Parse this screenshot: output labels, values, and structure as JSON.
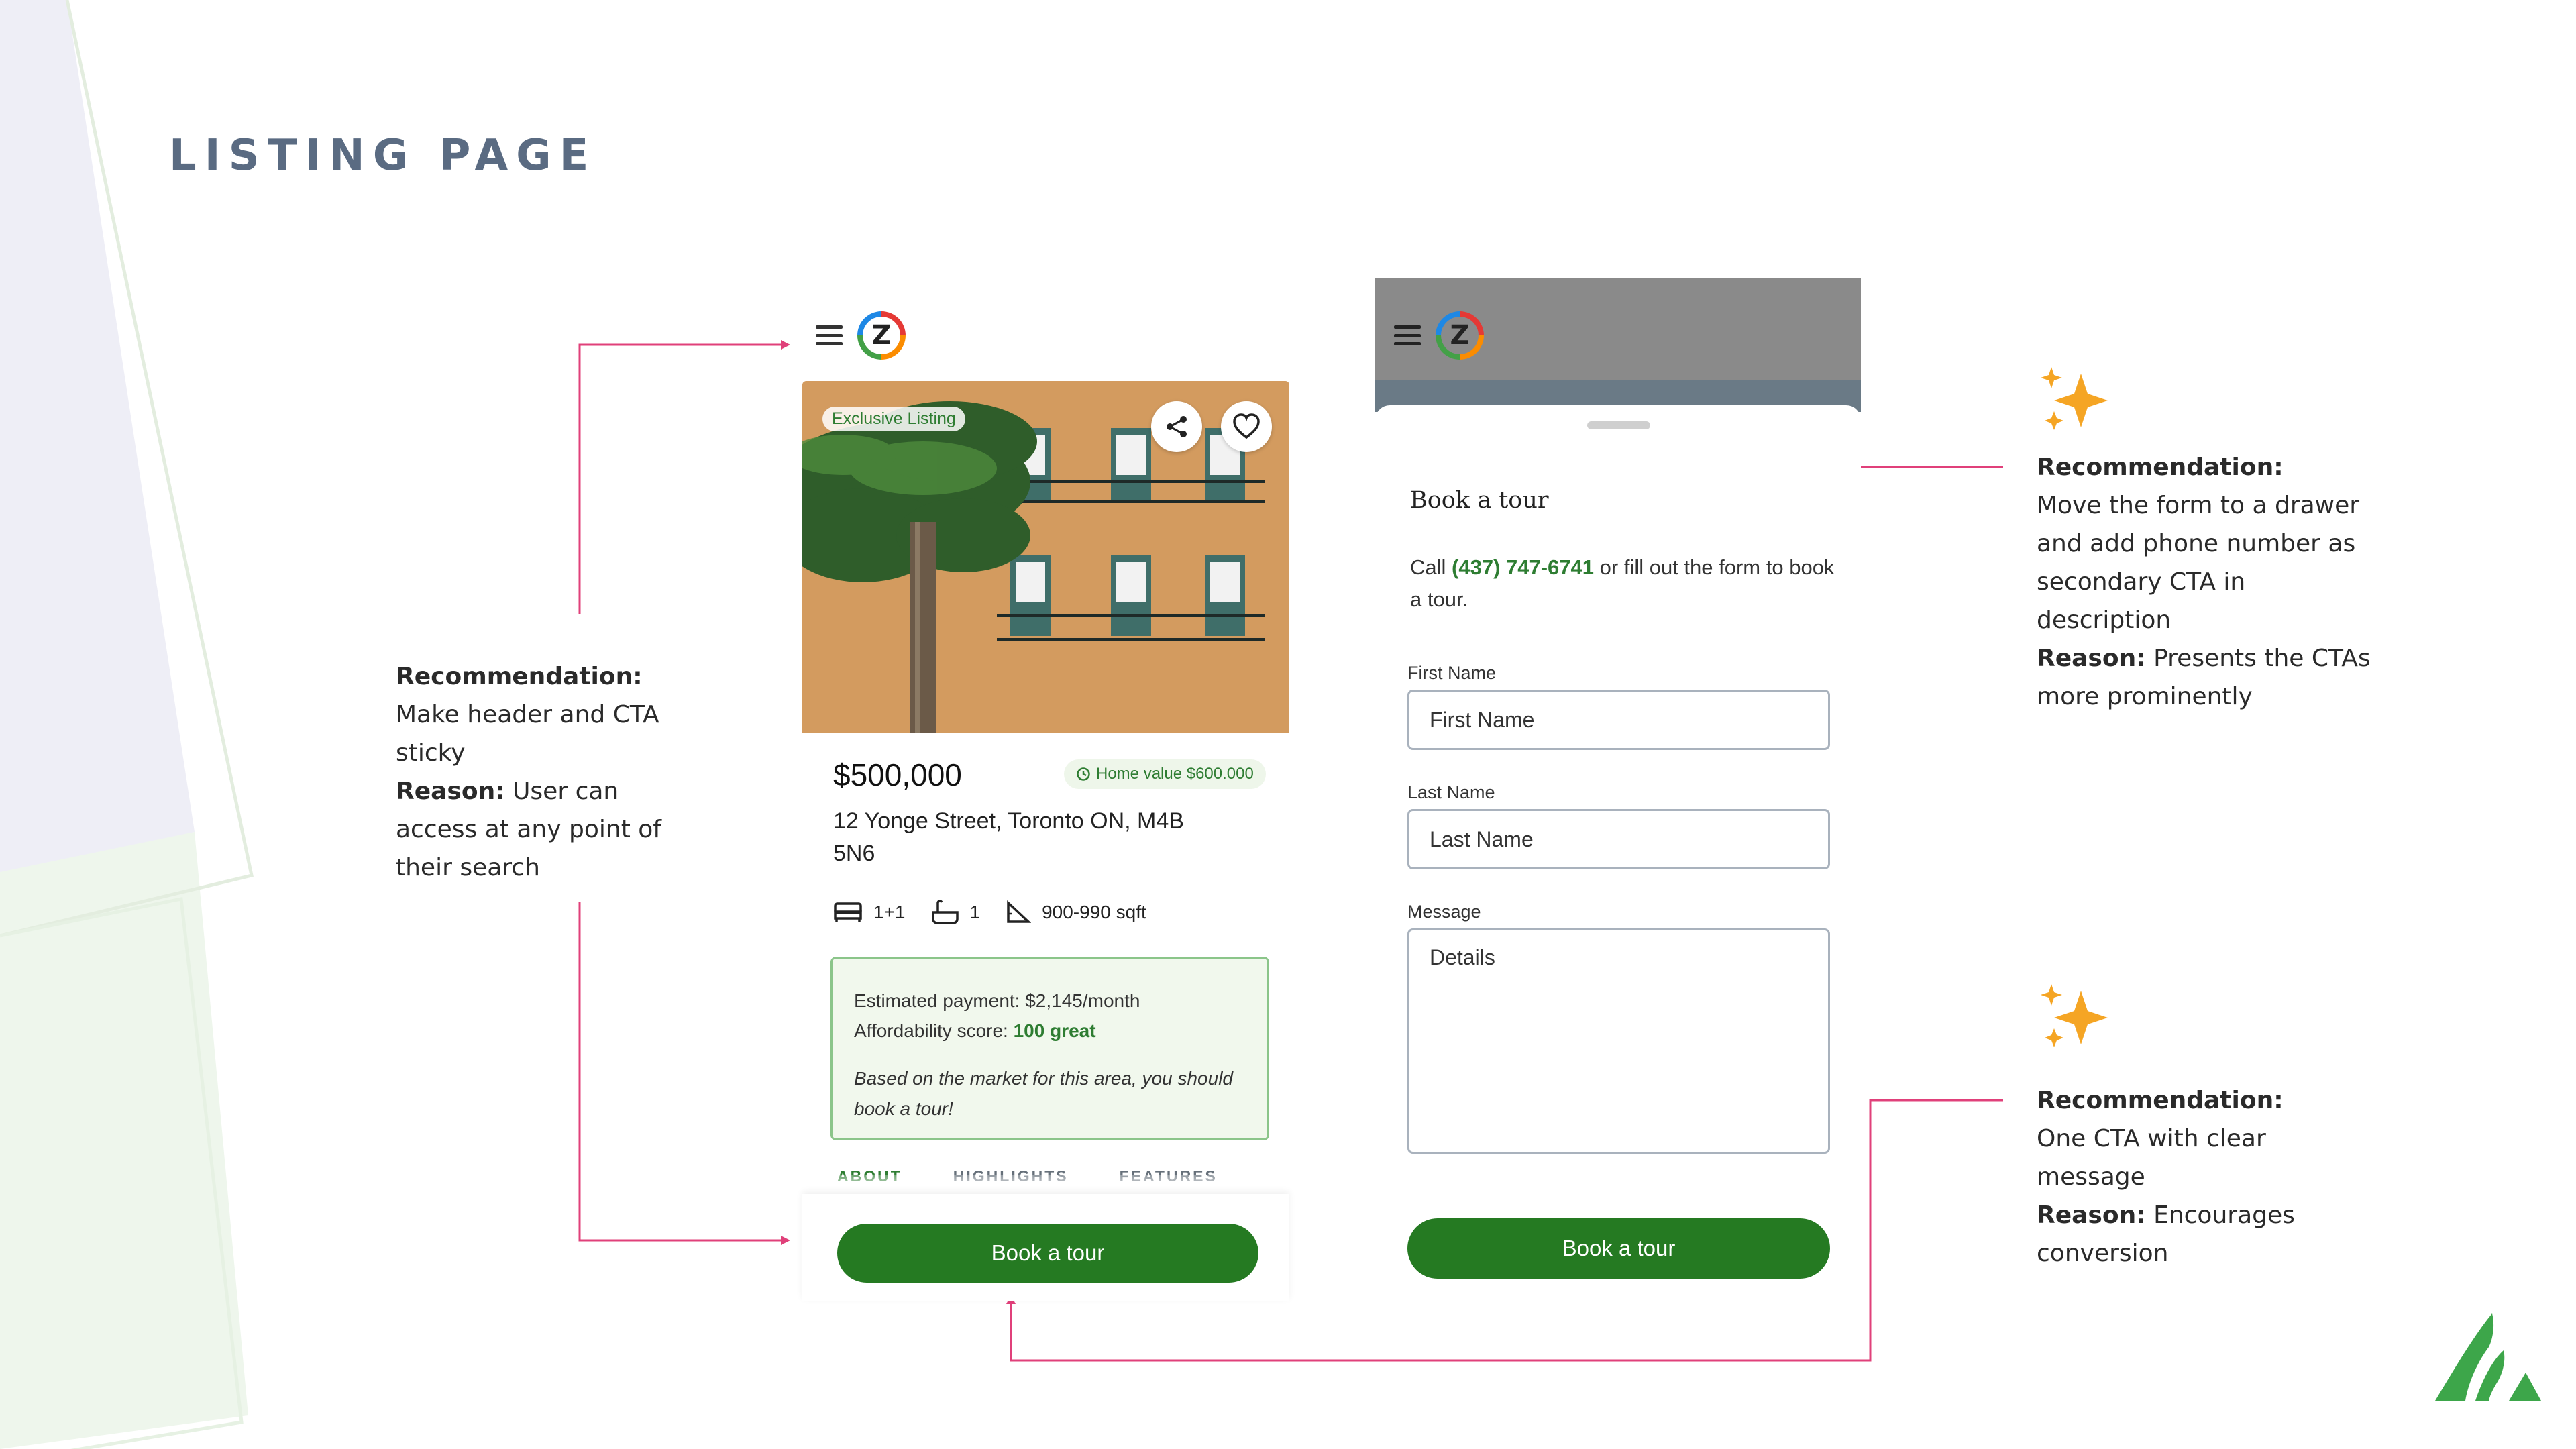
{
  "page_title": "LISTING PAGE",
  "notes": {
    "left": {
      "rec_label": "Recommendation:",
      "rec_text": "Make header and CTA sticky",
      "reason_label": "Reason:",
      "reason_text": "User can access at any point of their search"
    },
    "right_top": {
      "rec_label": "Recommendation:",
      "rec_text": "Move the form to a drawer and add phone number as secondary CTA in description",
      "reason_label": "Reason:",
      "reason_text": "Presents the CTAs more prominently"
    },
    "right_bottom": {
      "rec_label": "Recommendation:",
      "rec_text": "One CTA with clear message",
      "reason_label": "Reason:",
      "reason_text": "Encourages conversion"
    }
  },
  "listing": {
    "logo_letter": "Z",
    "badge": "Exclusive Listing",
    "price": "$500,000",
    "home_value": "Home value $600.000",
    "address": "12 Yonge Street, Toronto ON, M4B 5N6",
    "beds": "1+1",
    "baths": "1",
    "sqft": "900-990 sqft",
    "payment_line": "Estimated payment: $2,145/month",
    "score_label": "Affordability score:",
    "score_value": "100 great",
    "payment_note": "Based on the market for this area, you should book a tour!",
    "tabs": [
      "ABOUT",
      "HIGHLIGHTS",
      "FEATURES"
    ],
    "cta": "Book a tour"
  },
  "drawer": {
    "title": "Book a tour",
    "desc_prefix": "Call",
    "phone": "(437) 747-6741",
    "desc_suffix": "or fill out the form to book a tour.",
    "first_name_label": "First Name",
    "first_name_placeholder": "First Name",
    "last_name_label": "Last Name",
    "last_name_placeholder": "Last Name",
    "message_label": "Message",
    "message_placeholder": "Details",
    "cta": "Book a tour"
  },
  "colors": {
    "brand_green": "#257a22",
    "connector_pink": "#e0407a",
    "title_slate": "#5a6b82",
    "sparkle": "#f5a524"
  },
  "icons": [
    "hamburger-icon",
    "share-icon",
    "heart-icon",
    "bed-icon",
    "bath-icon",
    "area-icon",
    "sparkle-icon",
    "clock-icon"
  ]
}
